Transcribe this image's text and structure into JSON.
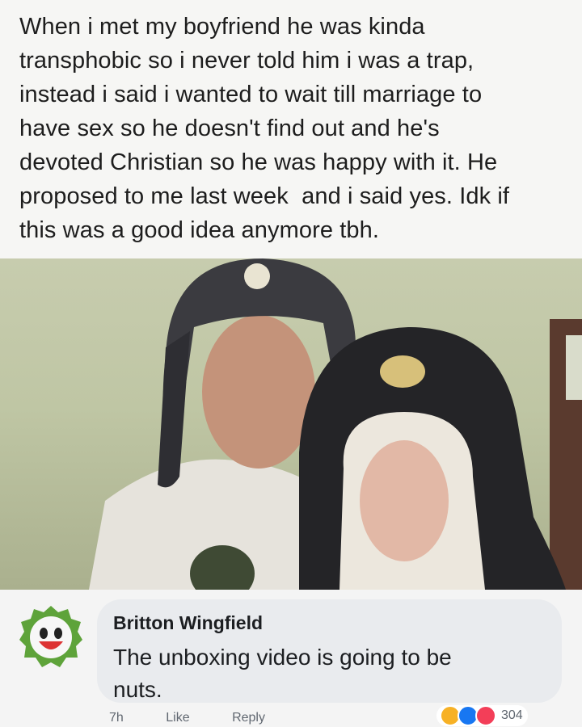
{
  "post": {
    "lines": [
      "When i met my boyfriend he was kinda",
      "transphobic so i never told him i was a trap,",
      "instead i said i wanted to wait till marriage to",
      "have sex so he doesn't find out and he's",
      "devoted Christian so he was happy with it. He",
      "proposed to me last week  and i said yes. Idk if",
      "this was a good idea anymore tbh."
    ]
  },
  "comment": {
    "author": "Britton Wingfield",
    "text_line1": "The unboxing video is going to be",
    "text_line2": "nuts.",
    "avatar_icon": "awesome-face-avatar-icon",
    "actions": {
      "time": "7h",
      "like": "Like",
      "reply": "Reply"
    },
    "reactions": {
      "icons": [
        "haha-reaction-icon",
        "like-reaction-icon",
        "love-reaction-icon"
      ],
      "count": "304"
    }
  },
  "colors": {
    "bubble": "#e9ebee",
    "like_blue": "#1877f2",
    "love_red": "#f33e58",
    "haha_yellow": "#f7b125"
  }
}
